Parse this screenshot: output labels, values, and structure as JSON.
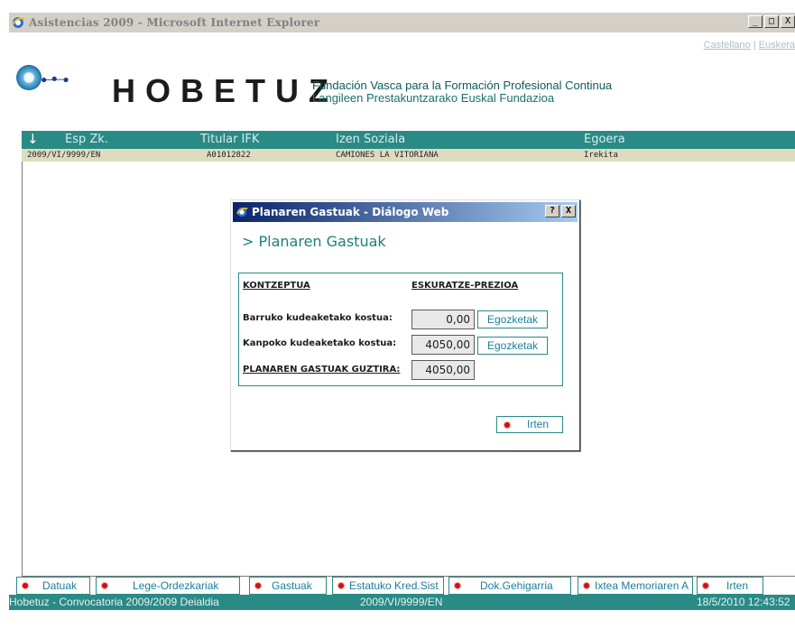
{
  "window": {
    "title": "Asistencias 2009 - Microsoft Internet Explorer",
    "min": "_",
    "max": "□",
    "close": "X"
  },
  "lang": {
    "castellano": "Castellano",
    "separator": " | ",
    "euskera": "Euskera"
  },
  "brand": {
    "name": "HOBETUZ",
    "sub1": "Fundación Vasca para la Formación Profesional Continua",
    "sub2": "Langileen Prestakuntzarako Euskal Fundazioa"
  },
  "grid": {
    "sort_icon": "↓",
    "headers": [
      "Esp Zk.",
      "Titular IFK",
      "Izen Soziala",
      "Egoera"
    ],
    "row": [
      "2009/VI/9999/EN",
      "A01012822",
      "CAMIONES LA VITORIANA",
      "Irekita"
    ]
  },
  "dialog": {
    "title": "Planaren Gastuak - Diálogo Web",
    "help": "?",
    "close": "X",
    "heading": "> Planaren Gastuak",
    "col_concept": "KONTZEPTUA",
    "col_price": "ESKURATZE-PREZIOA",
    "rows": [
      {
        "label": "Barruko kudeaketako kostua:",
        "value": "0,00",
        "button": "Egozketak"
      },
      {
        "label": "Kanpoko kudeaketako kostua:",
        "value": "4050,00",
        "button": "Egozketak"
      },
      {
        "label": "PLANAREN GASTUAK GUZTIRA:",
        "value": "4050,00"
      }
    ],
    "exit": "Irten"
  },
  "tabs": [
    "Datuak",
    "Lege-Ordezkariak",
    "Gastuak",
    "Estatuko Kred.Sist",
    "Dok.Gehigarria",
    "Ixtea Memoriaren A",
    "Irten"
  ],
  "status": {
    "left": "Hobetuz - Convocatoria 2009/2009 Deialdia",
    "center": "2009/VI/9999/EN",
    "right": "18/5/2010 12:43:52"
  },
  "colors": {
    "accent": "#2a8a86",
    "row_bg": "#dedcbf",
    "link": "#1a7f9c",
    "dot": "#d01010"
  }
}
